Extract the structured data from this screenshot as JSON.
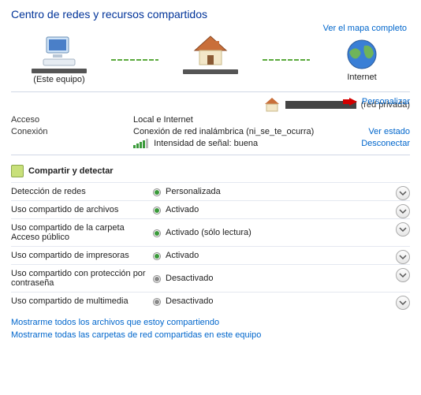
{
  "title": "Centro de redes y recursos compartidos",
  "view_full_map": "Ver el mapa completo",
  "map": {
    "this_pc": "(Este equipo)",
    "internet": "Internet"
  },
  "network": {
    "type_label": "(red privada)",
    "customize": "Personalizar",
    "access_label": "Acceso",
    "access_value": "Local e Internet",
    "connection_label": "Conexión",
    "connection_value": "Conexión de red inalámbrica (ni_se_te_ocurra)",
    "signal_label": "Intensidad de señal: buena",
    "view_status": "Ver estado",
    "disconnect": "Desconectar"
  },
  "share_header": "Compartir y detectar",
  "share_rows": [
    {
      "label": "Detección de redes",
      "value": "Personalizada",
      "state": "on"
    },
    {
      "label": "Uso compartido de archivos",
      "value": "Activado",
      "state": "on"
    },
    {
      "label": "Uso compartido de la carpeta Acceso público",
      "value": "Activado (sólo lectura)",
      "state": "on"
    },
    {
      "label": "Uso compartido de impresoras",
      "value": "Activado",
      "state": "on"
    },
    {
      "label": "Uso compartido con protección por contraseña",
      "value": "Desactivado",
      "state": "off"
    },
    {
      "label": "Uso compartido de multimedia",
      "value": "Desactivado",
      "state": "off"
    }
  ],
  "bottom_links": {
    "files": "Mostrarme todos los archivos que estoy compartiendo",
    "folders": "Mostrarme todas las carpetas de red compartidas en este equipo"
  }
}
